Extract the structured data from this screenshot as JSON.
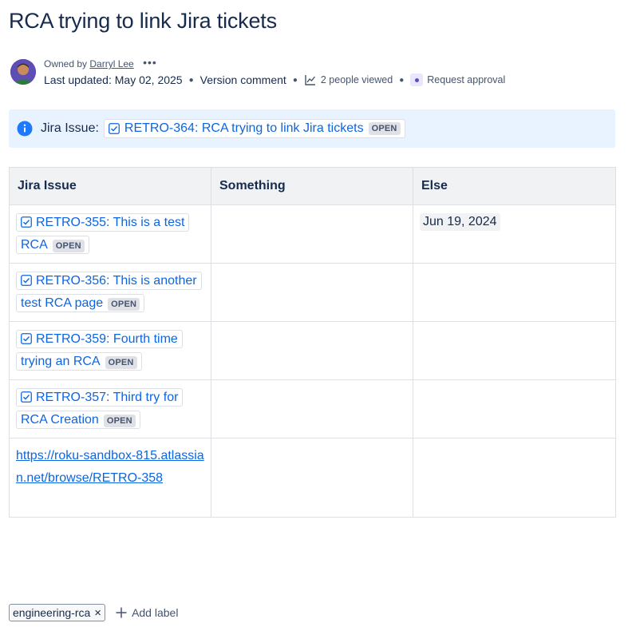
{
  "page": {
    "title": "RCA trying to link Jira tickets"
  },
  "byline": {
    "owned_by_prefix": "Owned by",
    "owner_name": "Darryl Lee",
    "more_label": "•••",
    "last_updated_label": "Last updated:",
    "last_updated_date": "May 02, 2025",
    "version_comment": "Version comment",
    "viewed": "2 people viewed",
    "request_approval": "Request approval"
  },
  "panel": {
    "label": "Jira Issue:",
    "issue_text": "RETRO-364: RCA trying to link Jira tickets",
    "status": "OPEN"
  },
  "table": {
    "headers": [
      "Jira Issue",
      "Something",
      "Else"
    ],
    "rows": [
      {
        "issue": "RETRO-355: This is a test RCA",
        "status": "OPEN",
        "something": "",
        "else": "Jun 19, 2024"
      },
      {
        "issue": "RETRO-356: This is another test RCA page",
        "status": "OPEN",
        "something": "",
        "else": ""
      },
      {
        "issue": "RETRO-359: Fourth time trying an RCA",
        "status": "OPEN",
        "something": "",
        "else": ""
      },
      {
        "issue": "RETRO-357: Third try for RCA Creation",
        "status": "OPEN",
        "something": "",
        "else": ""
      },
      {
        "link": "https://roku-sandbox-815.atlassian.net/browse/RETRO-358",
        "something": "",
        "else": ""
      }
    ]
  },
  "labels": {
    "items": [
      "engineering-rca"
    ],
    "remove_glyph": "×",
    "add_label": "Add label"
  },
  "colors": {
    "link": "#0c66e4",
    "panel_bg": "#e9f2ff",
    "info_icon": "#1d7afc",
    "header_bg": "#f1f2f4",
    "text": "#172b4d"
  },
  "icons": {
    "info": "info-icon",
    "issue_type": "checkbox-task-icon",
    "analytics": "trend-line-icon",
    "remove": "close-icon",
    "add": "plus-icon"
  }
}
